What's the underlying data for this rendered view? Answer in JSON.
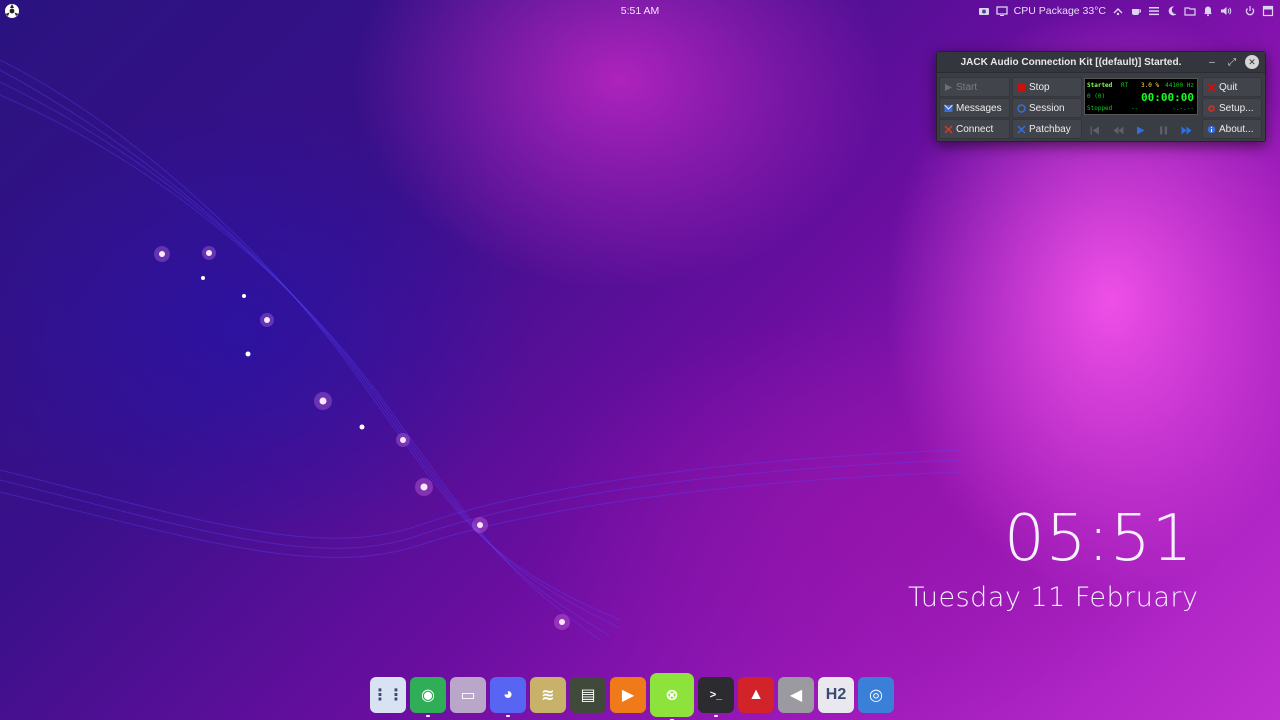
{
  "top_panel": {
    "clock": "5:51 AM",
    "cpu_sensor": "CPU Package 33°C",
    "icons": [
      "app-menu-icon",
      "screenshot-icon",
      "display-icon",
      "network-icon",
      "coffee-icon",
      "list-icon",
      "night-mode-icon",
      "folder-icon",
      "notification-icon",
      "volume-icon",
      "power-icon",
      "window-icon"
    ]
  },
  "jack": {
    "title": "JACK Audio Connection Kit [(default)] Started.",
    "buttons": {
      "start": "Start",
      "stop": "Stop",
      "quit": "Quit",
      "messages": "Messages",
      "session": "Session",
      "setup": "Setup...",
      "connect": "Connect",
      "patchbay": "Patchbay",
      "about": "About..."
    },
    "display": {
      "status": "Started",
      "rt": "RT",
      "dsp_load": "3.0 %",
      "sample_rate": "44100 Hz",
      "xruns": "0 (0)",
      "time": "00:00:00",
      "transport": "Stopped",
      "bpm": "--",
      "blank": "-.-.--"
    },
    "colors": {
      "display_green": "#14ff22",
      "stop_red": "#cc1010",
      "link_blue": "#3a6ed8"
    }
  },
  "desktop_clock": {
    "time": "05:51",
    "date": "Tuesday 11 February"
  },
  "dock": {
    "items": [
      {
        "name": "app-launcher-icon",
        "color": "#d8e2f2",
        "glyph": "⋮⋮"
      },
      {
        "name": "chrome-icon",
        "color": "#2fae57",
        "glyph": "◉"
      },
      {
        "name": "files-icon",
        "color": "#b9a6c8",
        "glyph": "▭"
      },
      {
        "name": "discord-icon",
        "color": "#5865f2",
        "glyph": "◕"
      },
      {
        "name": "mixer-icon",
        "color": "#c8b26a",
        "glyph": "≋"
      },
      {
        "name": "audio-interface-icon",
        "color": "#3f4a3a",
        "glyph": "▤"
      },
      {
        "name": "media-player-icon",
        "color": "#f07a1a",
        "glyph": "▶"
      },
      {
        "name": "jack-cable-icon",
        "color": "#8ee23c",
        "glyph": "⊗"
      },
      {
        "name": "terminal-icon",
        "color": "#2b2b30",
        "glyph": ">_"
      },
      {
        "name": "ardour-icon",
        "color": "#d2222a",
        "glyph": "▲"
      },
      {
        "name": "volume-control-icon",
        "color": "#9a9aa0",
        "glyph": "◀"
      },
      {
        "name": "hydrogen-icon",
        "color": "#e8e8ee",
        "glyph": "H2"
      },
      {
        "name": "screenshot-app-icon",
        "color": "#3a80d8",
        "glyph": "◎"
      }
    ]
  }
}
